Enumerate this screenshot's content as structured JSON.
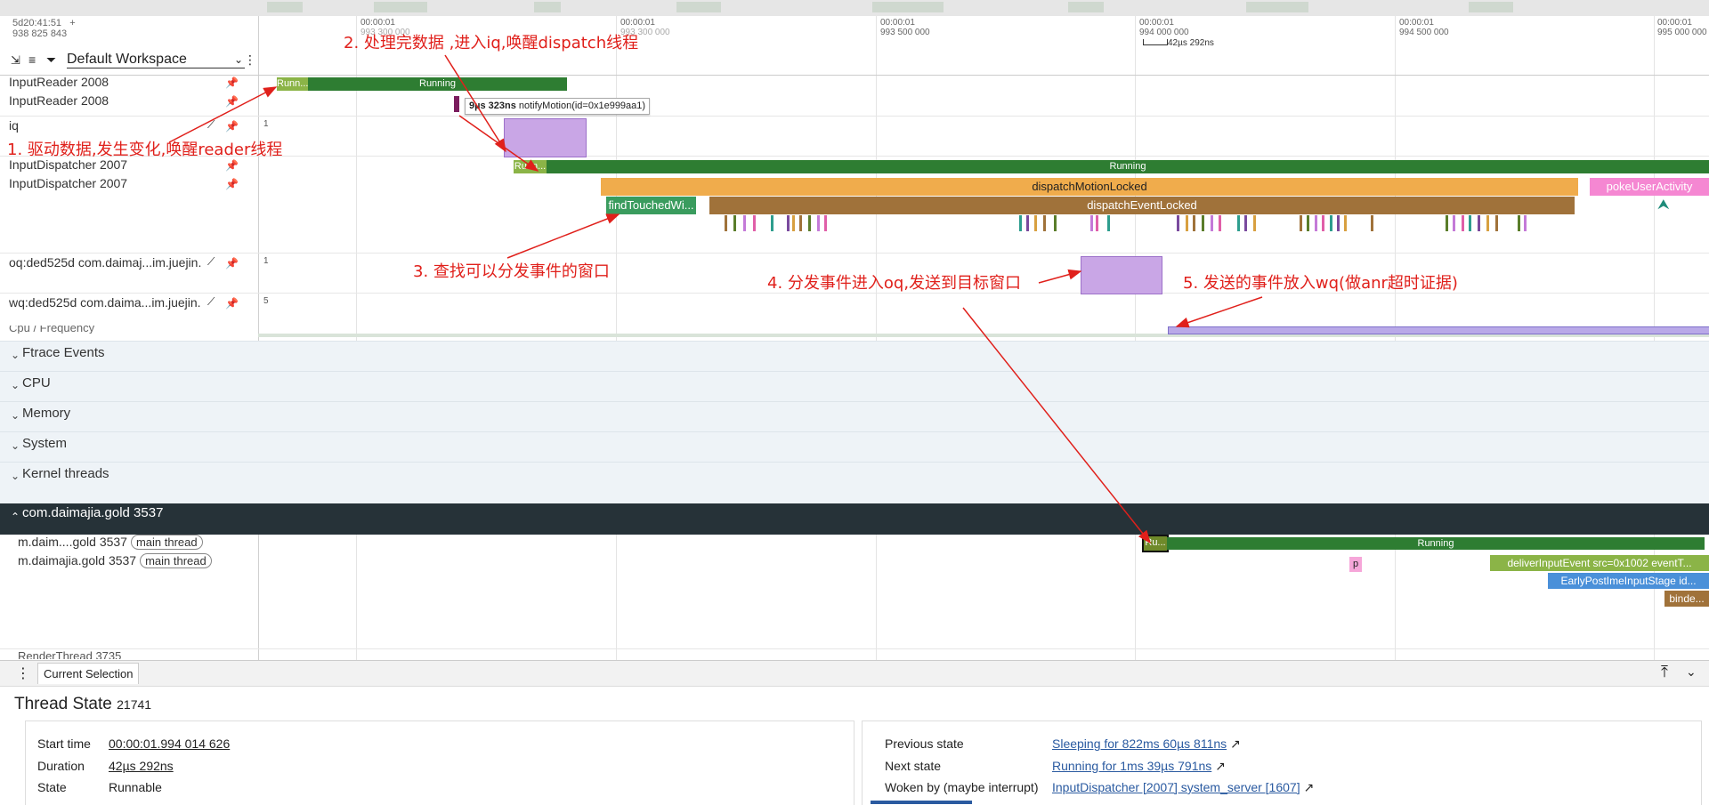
{
  "header": {
    "timestamp_line1": "5d20:41:51",
    "timestamp_plus": "+",
    "timestamp_line2": "938 825 843",
    "workspace": "Default Workspace",
    "ticks": [
      {
        "top": "00:00:01",
        "bottom": "993 250 000"
      },
      {
        "top": "00:00:01",
        "bottom": "993 300 000"
      },
      {
        "top": "00:00:01",
        "bottom": "993 500 000"
      },
      {
        "top": "00:00:01",
        "bottom": "994 000 000"
      },
      {
        "top": "00:00:01",
        "bottom": "994 500 000"
      },
      {
        "top": "00:00:01",
        "bottom": "995 000 000"
      }
    ],
    "duration_marker": "42µs 292ns"
  },
  "tracks": {
    "inputreader1": "InputReader 2008",
    "inputreader2": "InputReader 2008",
    "iq": "iq",
    "iq_value": "1",
    "dispatcher1": "InputDispatcher 2007",
    "dispatcher2": "InputDispatcher 2007",
    "oq": "oq:ded525d com.daimaj...im.juejin.",
    "oq_value": "1",
    "wq": "wq:ded525d com.daima...im.juejin.",
    "wq_value": "5",
    "cpu_freq_partial": "Cpu / Frequency"
  },
  "slices": {
    "reader_runn": "Runn...",
    "reader_running": "Running",
    "tooltip_time": "9µs 323ns",
    "tooltip_text": "notifyMotion(id=0x1e999aa1)",
    "disp_runn": "Runn...",
    "disp_running": "Running",
    "dispatchMotionLocked": "dispatchMotionLocked",
    "pokeUserActivity": "pokeUserActivity",
    "findTouchedWi": "findTouchedWi...",
    "dispatchEventLocked": "dispatchEventLocked",
    "main_ru": "Ru...",
    "main_running": "Running",
    "p": "p",
    "deliverInputEvent": "deliverInputEvent src=0x1002 eventT...",
    "earlyPostIme": "EarlyPostImeInputStage id...",
    "binde": "binde..."
  },
  "annotations": {
    "a1": "1. 驱动数据,发生变化,唤醒reader线程",
    "a2": "2. 处理完数据 ,进入iq,唤醒dispatch线程",
    "a3": "3. 查找可以分发事件的窗口",
    "a4": "4. 分发事件进入oq,发送到目标窗口",
    "a5": "5. 发送的事件放入wq(做anr超时证据)"
  },
  "groups": {
    "ftrace": "Ftrace Events",
    "cpu": "CPU",
    "memory": "Memory",
    "system": "System",
    "kernel": "Kernel threads",
    "process": "com.daimajia.gold 3537"
  },
  "process_tracks": {
    "main1": "m.daim....gold 3537",
    "main1_pill": "main thread",
    "main2": "m.daimajia.gold 3537",
    "main2_pill": "main thread",
    "render_partial": "RenderThread 3735"
  },
  "details": {
    "tab": "Current Selection",
    "title": "Thread State",
    "title_id": "21741",
    "start_time_label": "Start time",
    "start_time": "00:00:01.994 014 626",
    "duration_label": "Duration",
    "duration": "42µs 292ns",
    "state_label": "State",
    "state": "Runnable",
    "prev_label": "Previous state",
    "prev": "Sleeping for 822ms 60µs 811ns",
    "next_label": "Next state",
    "next": "Running for 1ms 39µs 791ns",
    "woken_label": "Woken by (maybe interrupt)",
    "woken": "InputDispatcher [2007] system_server [1607]"
  },
  "colors": {
    "running_green": "#2e7d32",
    "runnable_lightgreen": "#8bb447",
    "orange": "#f0ac4c",
    "brown": "#a0723a",
    "purple": "#b39ddb",
    "pink": "#f587d2",
    "blue": "#4a90d9",
    "annotation_red": "#e0201b",
    "group_header_dark": "#263238"
  }
}
